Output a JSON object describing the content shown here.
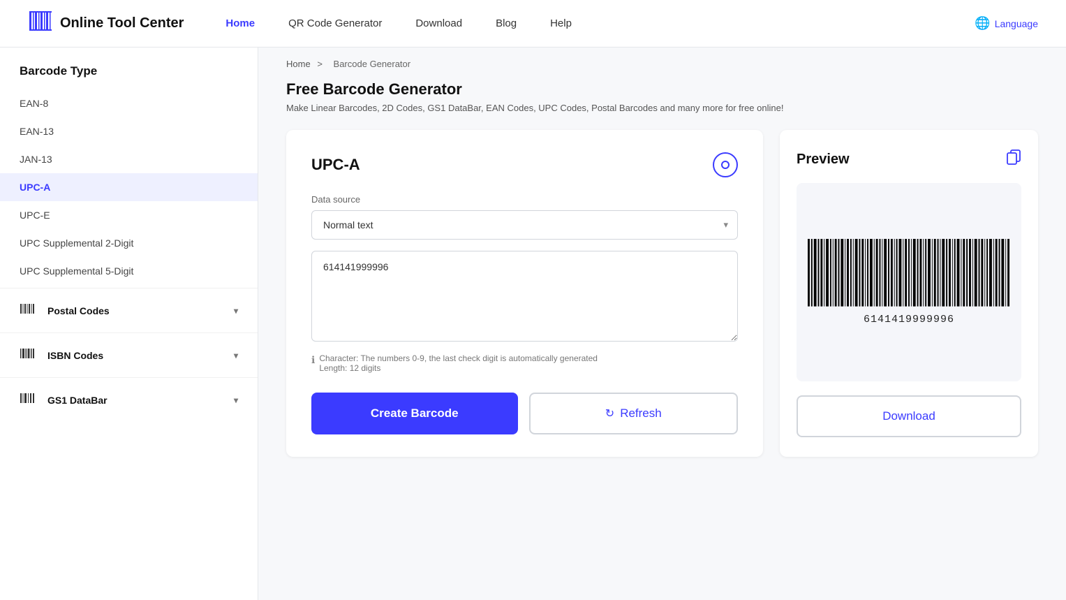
{
  "header": {
    "logo_text": "Online Tool Center",
    "nav": [
      {
        "label": "Home",
        "active": true
      },
      {
        "label": "QR Code Generator",
        "active": false
      },
      {
        "label": "Download",
        "active": false
      },
      {
        "label": "Blog",
        "active": false
      },
      {
        "label": "Help",
        "active": false
      }
    ],
    "language_label": "Language"
  },
  "sidebar": {
    "title": "Barcode Type",
    "items": [
      {
        "label": "EAN-8",
        "active": false
      },
      {
        "label": "EAN-13",
        "active": false
      },
      {
        "label": "JAN-13",
        "active": false
      },
      {
        "label": "UPC-A",
        "active": true
      },
      {
        "label": "UPC-E",
        "active": false
      },
      {
        "label": "UPC Supplemental 2-Digit",
        "active": false
      },
      {
        "label": "UPC Supplemental 5-Digit",
        "active": false
      }
    ],
    "groups": [
      {
        "label": "Postal Codes"
      },
      {
        "label": "ISBN Codes"
      },
      {
        "label": "GS1 DataBar"
      }
    ]
  },
  "breadcrumb": {
    "home": "Home",
    "separator": ">",
    "current": "Barcode Generator"
  },
  "main": {
    "title": "Free Barcode Generator",
    "subtitle": "Make Linear Barcodes, 2D Codes, GS1 DataBar, EAN Codes, UPC Codes, Postal Barcodes and many more for free online!",
    "form": {
      "barcode_type": "UPC-A",
      "data_source_label": "Data source",
      "data_source_value": "Normal text",
      "data_source_options": [
        "Normal text"
      ],
      "barcode_value": "614141999996",
      "hint_line1": "Character: The numbers 0-9, the last check digit is automatically generated",
      "hint_line2": "Length: 12 digits",
      "create_button": "Create Barcode",
      "refresh_button": "Refresh"
    },
    "preview": {
      "title": "Preview",
      "barcode_number": "6141419999996",
      "download_button": "Download"
    }
  }
}
